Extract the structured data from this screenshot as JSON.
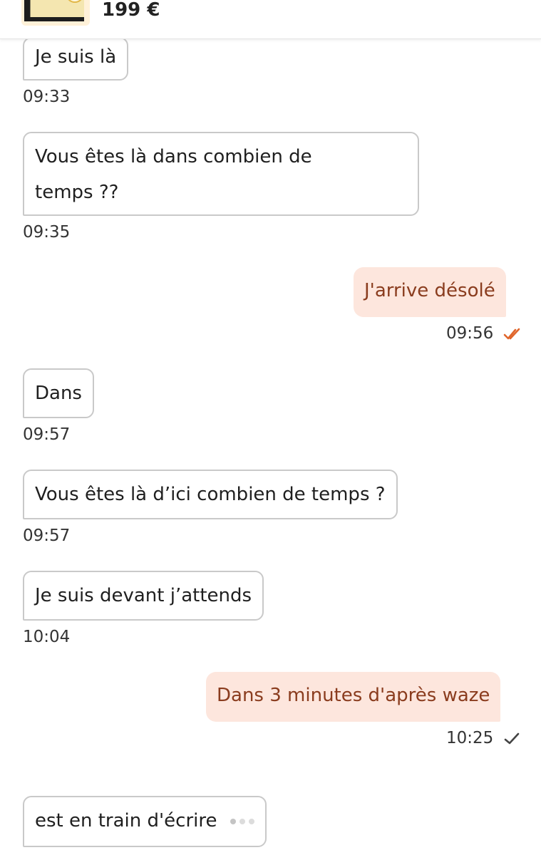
{
  "header": {
    "price": "199 €"
  },
  "messages": [
    {
      "text": "Je suis là",
      "time": "09:33"
    },
    {
      "text": "Vous êtes là dans combien de temps ??",
      "line1": "Vous êtes là dans combien de",
      "line2": "temps ??",
      "time": "09:35"
    },
    {
      "text": "J'arrive désolé",
      "time": "09:56",
      "status": "read"
    },
    {
      "text": "Dans",
      "time": "09:57"
    },
    {
      "text": "Vous êtes là d’ici combien de temps ?",
      "time": "09:57"
    },
    {
      "text": "Je suis devant j’attends",
      "time": "10:04"
    },
    {
      "text": "Dans 3 minutes d'après waze",
      "time": "10:25",
      "status": "sent"
    }
  ],
  "typing": {
    "text": "est en train d'écrire"
  },
  "colors": {
    "outgoing_bubble": "#fde6dd",
    "outgoing_text": "#8a3c1e",
    "read_check": "#e0662c",
    "sent_check": "#444444"
  }
}
